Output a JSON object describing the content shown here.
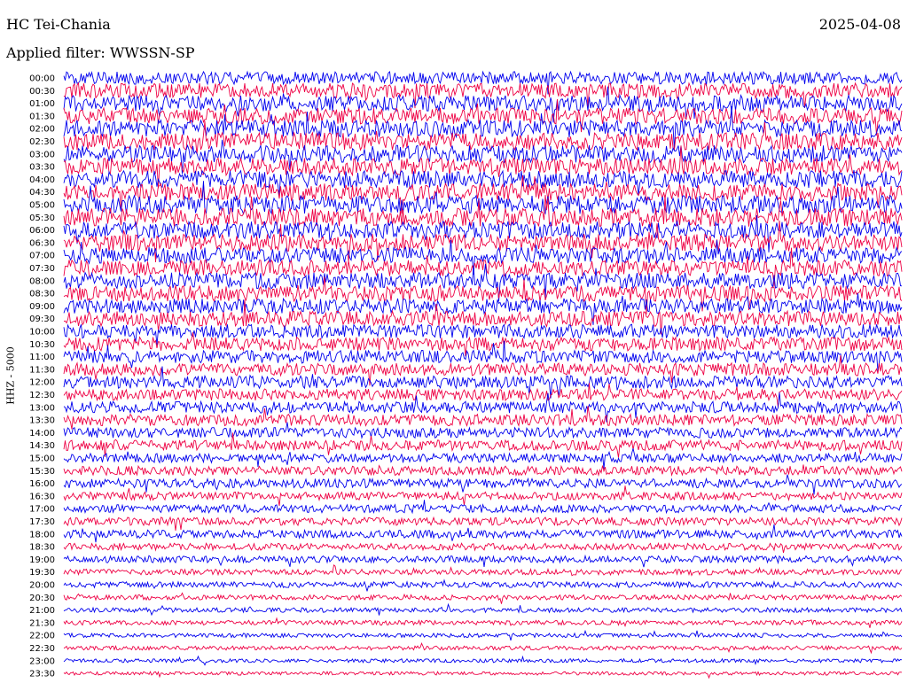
{
  "header": {
    "station": "HC Tei-Chania",
    "date": "2025-04-08",
    "filter_label": "Applied filter:",
    "filter_value": "WWSSN-SP"
  },
  "chart_data": {
    "type": "line",
    "kind": "helicorder",
    "title": "HC Tei-Chania",
    "date": "2025-04-08",
    "filter": "WWSSN-SP",
    "ylabel": "HHZ - 5000",
    "xlabel": "",
    "grid": false,
    "legend": "none",
    "row_interval_minutes": 30,
    "row_labels": [
      "00:00",
      "00:30",
      "01:00",
      "01:30",
      "02:00",
      "02:30",
      "03:00",
      "03:30",
      "04:00",
      "04:30",
      "05:00",
      "05:30",
      "06:00",
      "06:30",
      "07:00",
      "07:30",
      "08:00",
      "08:30",
      "09:00",
      "09:30",
      "10:00",
      "10:30",
      "11:00",
      "11:30",
      "12:00",
      "12:30",
      "13:00",
      "13:30",
      "14:00",
      "14:30",
      "15:00",
      "15:30",
      "16:00",
      "16:30",
      "17:00",
      "17:30",
      "18:00",
      "18:30",
      "19:00",
      "19:30",
      "20:00",
      "20:30",
      "21:00",
      "21:30",
      "22:00",
      "22:30",
      "23:00",
      "23:30"
    ],
    "trace_colors": [
      "#0000ee",
      "#ee0044"
    ],
    "relative_noise_amplitude": [
      0.55,
      0.65,
      0.7,
      0.7,
      0.75,
      0.75,
      0.75,
      0.75,
      0.75,
      0.75,
      0.8,
      0.8,
      0.75,
      0.75,
      0.7,
      0.7,
      0.7,
      0.7,
      0.65,
      0.65,
      0.6,
      0.6,
      0.55,
      0.55,
      0.55,
      0.5,
      0.5,
      0.5,
      0.45,
      0.45,
      0.4,
      0.4,
      0.4,
      0.35,
      0.35,
      0.35,
      0.35,
      0.3,
      0.3,
      0.25,
      0.25,
      0.22,
      0.2,
      0.2,
      0.18,
      0.18,
      0.16,
      0.15
    ],
    "annotations": []
  }
}
